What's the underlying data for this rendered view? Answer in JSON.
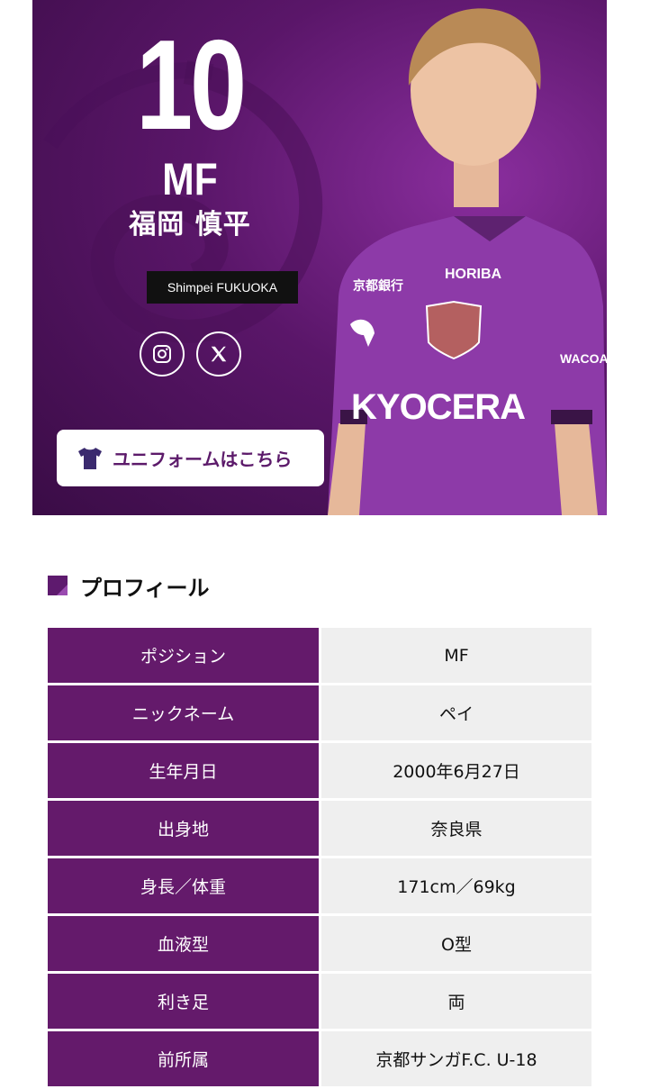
{
  "hero": {
    "number": "10",
    "position": "MF",
    "name_ja": "福岡 慎平",
    "name_en": "Shimpei FUKUOKA",
    "uniform_button_label": "ユニフォームはこちら",
    "jersey": {
      "sponsor_top_left": "京都銀行",
      "sponsor_top_right": "HORIBA",
      "sponsor_chest": "KYOCERA",
      "sponsor_sleeve": "WACOAL"
    }
  },
  "profile": {
    "title": "プロフィール",
    "rows": [
      {
        "label": "ポジション",
        "value": "MF"
      },
      {
        "label": "ニックネーム",
        "value": "ペイ"
      },
      {
        "label": "生年月日",
        "value": "2000年6月27日"
      },
      {
        "label": "出身地",
        "value": "奈良県"
      },
      {
        "label": "身長／体重",
        "value": "171cm／69kg"
      },
      {
        "label": "血液型",
        "value": "O型"
      },
      {
        "label": "利き足",
        "value": "両"
      },
      {
        "label": "前所属",
        "value": "京都サンガF.C. U-18"
      }
    ]
  },
  "icons": [
    "instagram-icon",
    "x-icon",
    "tshirt-icon"
  ],
  "colors": {
    "brand_purple": "#641a6b",
    "hero_bg": "#5a1669",
    "row_value_bg": "#efefef"
  }
}
